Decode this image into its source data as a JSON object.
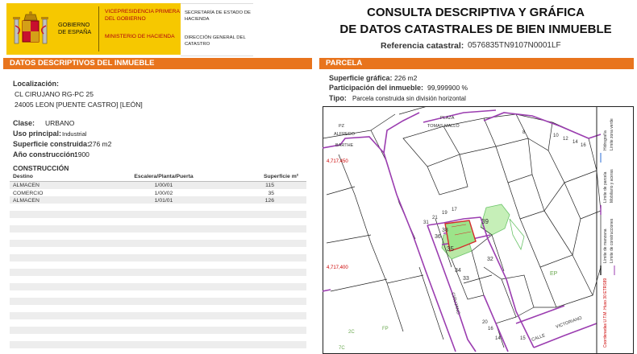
{
  "header": {
    "government_name": "GOBIERNO DE ESPAÑA",
    "vice_presidency": "VICEPRESIDENCIA PRIMERA DEL GOBIERNO",
    "ministry": "MINISTERIO DE HACIENDA",
    "secretary": "SECRETARÍA DE ESTADO DE HACIENDA",
    "directorate": "DIRECCIÓN GENERAL DEL CATASTRO",
    "title_line1": "CONSULTA DESCRIPTIVA Y GRÁFICA",
    "title_line2": "DE DATOS CATASTRALES DE BIEN INMUEBLE",
    "ref_label": "Referencia catastral:",
    "ref_value": "0576835TN9107N0001LF",
    "brand_color": "#f6c800",
    "accent_color": "#e8741d"
  },
  "left": {
    "section_title": "DATOS DESCRIPTIVOS DEL INMUEBLE",
    "localizacion_label": "Localización:",
    "address_line1": "CL CIRUJANO RG-PC 25",
    "address_line2": "24005 LEON [PUENTE CASTRO] [LEÓN]",
    "clase_label": "Clase:",
    "clase_value": "URBANO",
    "uso_label": "Uso principal:",
    "uso_value": "Industrial",
    "superficie_label": "Superficie construida:",
    "superficie_value": "276 m2",
    "ano_label": "Año construcción:",
    "ano_value": "1900",
    "construccion_title": "CONSTRUCCIÓN",
    "table": {
      "headers": [
        "Destino",
        "Escalera/Planta/Puerta",
        "Superficie m²"
      ],
      "rows": [
        [
          "ALMACEN",
          "1/00/01",
          "115"
        ],
        [
          "COMERCIO",
          "1/00/02",
          "35"
        ],
        [
          "ALMACEN",
          "1/01/01",
          "126"
        ]
      ]
    }
  },
  "right": {
    "section_title": "PARCELA",
    "sup_grafica_label": "Superficie gráfica:",
    "sup_grafica_value": "226 m2",
    "participacion_label": "Participación del inmueble:",
    "participacion_value": "99,999900 %",
    "tipo_label": "Tipo:",
    "tipo_value": "Parcela construida sin división horizontal"
  },
  "map": {
    "labels": {
      "plaza1": "PLAZA",
      "plaza2": "TOMAS MALLO",
      "pz": "PZ",
      "alfredo": "ALFREDO",
      "barthe": "BARTHE",
      "coord_top": "4,717,450",
      "coord_bottom": "4,717,400",
      "n8": "8",
      "n10": "10",
      "n12": "12",
      "n14": "14",
      "n16": "16",
      "n39": "39",
      "n38": "38",
      "n36": "36",
      "n35": "35",
      "n34": "34",
      "n33": "33",
      "n32": "32",
      "n31": "31",
      "n21": "21",
      "n17": "17",
      "n19": "19",
      "ep": "EP",
      "cirujano": "CIRUJANO",
      "calle_bottom": "CALLE",
      "victoriano": "VICTORIANO",
      "fp": "FP",
      "n2c": "2C",
      "n7c": "7C",
      "n20": "20",
      "n16b": "16",
      "n14b": "14",
      "n15": "15"
    },
    "legend": {
      "limite_manzana": "Límite de manzana",
      "limite_parcela": "Límite de parcela",
      "limite_construcciones": "Límite de construcciones",
      "mobiliario": "Mobiliario y aceras",
      "limite_verde": "Límite zona verde",
      "hidrografia": "Hidrografía",
      "coords_footer": "Coordenadas U.T.M. Huso 30 ETRS89"
    }
  }
}
